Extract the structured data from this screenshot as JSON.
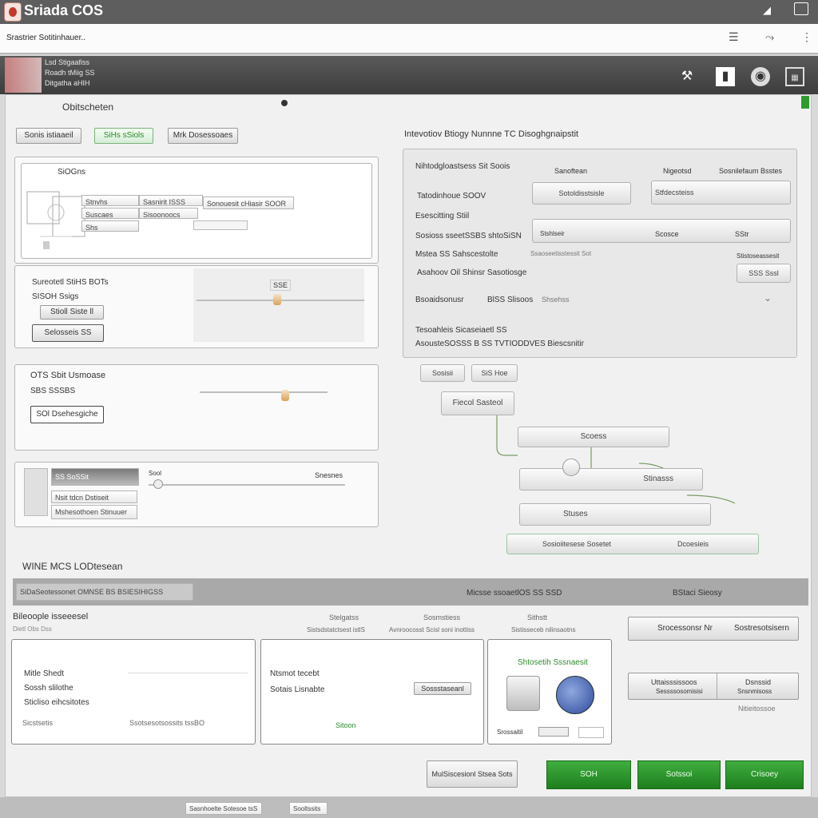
{
  "app": {
    "title": "Sriada COS"
  },
  "menubar": {
    "label": "Srastrier Sotitinhauer.."
  },
  "header": {
    "lines": [
      "Lsd Stigaafiss",
      "Roadh tMiig SS",
      "Ditgatha aHIH"
    ]
  },
  "left": {
    "section_title": "Obitscheten",
    "buttons": [
      "Sonis istiaaeil",
      "SiHs sSiols",
      "Mrk Dosessoaes"
    ],
    "panel1": {
      "title": "SiOGns",
      "rows": [
        "Stnvhs",
        "Suscaes",
        "Shs"
      ],
      "field_values": [
        "Sasnirit ISSS",
        "Sisoonoocs",
        "Sonouesit cHiasir SOOR"
      ]
    },
    "panel2": {
      "title": "Sureotetl StiHS BOTs",
      "subtitle": "SISOH Ssigs",
      "btn1": "Stioll Siste ll",
      "btn2": "Selosseis SS",
      "slider_value": "SSE"
    },
    "panel3": {
      "title": "OTS Sbit Usmoase",
      "subtitle": "SBS SSSBS",
      "btn": "SOl Dsehesgiche"
    },
    "panel4": {
      "chip": "SS SoSSit",
      "label": "Sool",
      "right_label": "Snesnes",
      "row1": "Nsit tdcn Dstiseit",
      "row2": "Mshesothoen Stinuuer"
    }
  },
  "right": {
    "section_title": "Intevotiov Btiogy Nunnne  TC Disoghgnaipstit",
    "header_row": {
      "label": "Nihtodgloastsess Sit Soois",
      "col1": "Sanoftean",
      "col2": "Nigeotsd",
      "col3": "Sosnilefaum Bsstes"
    },
    "rows": [
      {
        "label": "Tatodinhoue SOOV",
        "v1": "Sotoldisstsisle",
        "v2": "Stfdecsteiss"
      },
      {
        "label": "Esescitting Stiil",
        "v1": "",
        "v2": ""
      },
      {
        "label": "Sosioss sseetSSBS shtoSiSN",
        "v1": "Stshlseir",
        "v2": "Scosce",
        "v3": "SStr"
      },
      {
        "label": "Mstea SS Sahscestolte",
        "v1": "Ssaoseetisstessit Sot",
        "v2": "Stistoseassesit"
      },
      {
        "label": "Asahoov Oil Shinsr Sasotiosge",
        "v1": "",
        "v2": "SSS Sssl"
      },
      {
        "label": "Bsoaidsonusr",
        "v1": "BlSS Slisoos",
        "v2": "Shsehss"
      }
    ],
    "footer_line1": "Tesoahleis Sicaseiaetl SS",
    "footer_line2": "AsousteSOSSS B SS  TVTIODDVES  Biescsnitir",
    "mini_buttons": [
      "Sosisii",
      "SiS Hoe"
    ],
    "flow": [
      "Fiecol Sasteol",
      "Scoess",
      "Stinasss",
      "Stuses",
      "Sosioiitesese Sosetet"
    ],
    "flow_last_right": "Dcoesieis"
  },
  "bottom": {
    "title": "WINE MCS LODtesean",
    "band_left": "SiDaSeotessonet OMNSE BS BSIESIHIGSS",
    "band_mid": "Micsse ssoaetlOS SS SSD",
    "band_right": "BStaci Sieosy",
    "sub_title": "Bileoople isseeesel",
    "sub_sub": "Dietl Obs Dss",
    "columns": [
      {
        "h": "Stelgatss",
        "s": "Sistsdstatctsest istlS"
      },
      {
        "h": "Sosmstiess",
        "s": "Avnroocosst Scisl soni inottiss"
      },
      {
        "h": "Sithstt",
        "s": "Sistisseceb nilinsaotns"
      }
    ],
    "card1": {
      "rows": [
        "Mitle Shedt",
        "Sossh slilothe",
        "Sticliso eihcsitotes"
      ],
      "foot_left": "Sicstsetis",
      "foot_right": "Ssotsesotsossits tssBO"
    },
    "card2": {
      "rows": [
        "Ntsmot tecebt",
        "Sotais Lisnabte"
      ],
      "btn": "Sossstaseanl",
      "foot": "Sitoon"
    },
    "card3": {
      "title": "Shtosetih Sssnaesit",
      "foot": "Srossaitil"
    },
    "right_btn1": {
      "a": "Srocessonsr Nr",
      "b": "Sostresotsisern"
    },
    "right_btn2": {
      "a": "Uttaisssissoos",
      "a2": "Sessssosomisisi",
      "b": "Dsnssid",
      "b2": "Snsnmisoss"
    },
    "right_caption": "Nitieitossoe",
    "action_left": "MulSiscesionl Stsea Sots",
    "actions": [
      "SOH",
      "Sotssoi",
      "Crisoey"
    ]
  },
  "footer": {
    "tabs": [
      "Sasnhoelte Sotesoe tsS",
      "Sooltssits"
    ]
  },
  "colors": {
    "titlebar": "#5e5e5e",
    "accent_green": "#2f9b2f",
    "header_band": "#4a4a4a"
  }
}
